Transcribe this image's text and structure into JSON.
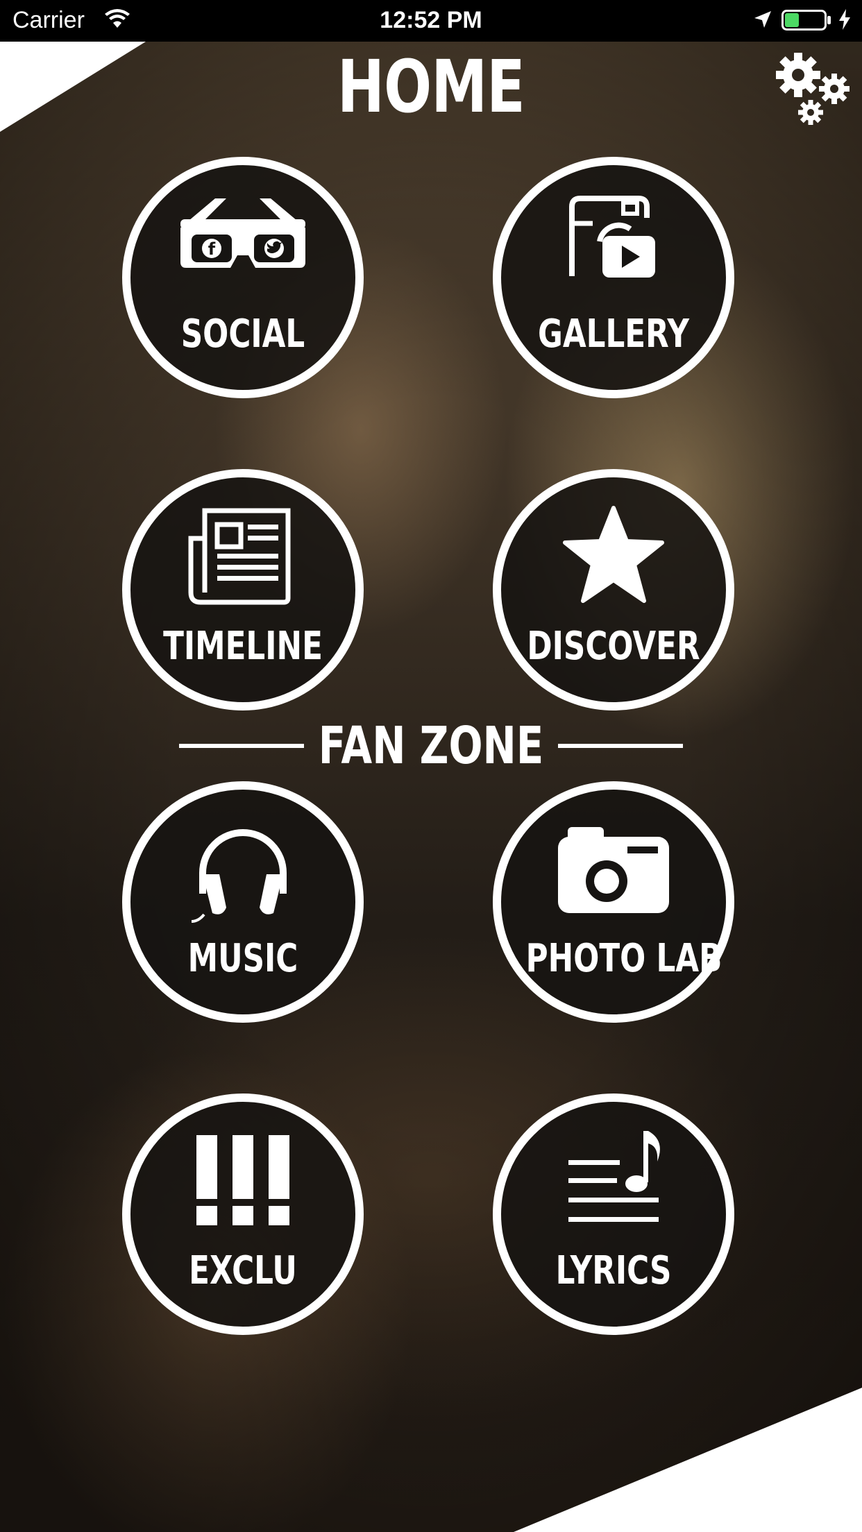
{
  "status_bar": {
    "carrier": "Carrier",
    "time": "12:52 PM",
    "wifi_icon": "wifi-icon",
    "location_icon": "location-arrow-icon",
    "battery_icon": "battery-icon",
    "charge_icon": "charging-bolt-icon"
  },
  "header": {
    "title": "HOME",
    "settings_icon": "gears-icon"
  },
  "main": {
    "tiles": [
      {
        "label": "SOCIAL",
        "icon": "social-glasses-icon"
      },
      {
        "label": "GALLERY",
        "icon": "gallery-camera-video-icon"
      },
      {
        "label": "TIMELINE",
        "icon": "newspaper-icon"
      },
      {
        "label": "DISCOVER",
        "icon": "star-icon"
      }
    ],
    "section_title": "FAN ZONE",
    "fan_tiles": [
      {
        "label": "MUSIC",
        "icon": "headphones-icon"
      },
      {
        "label": "PHOTO LAB",
        "icon": "camera-icon"
      },
      {
        "label": "EXCLU",
        "icon": "exclamation-icon"
      },
      {
        "label": "LYRICS",
        "icon": "lyrics-note-icon"
      }
    ]
  },
  "colors": {
    "accent": "#ffffff",
    "tile_background": "#161412",
    "status_bar": "#000000",
    "battery_level": "#4cd964"
  }
}
